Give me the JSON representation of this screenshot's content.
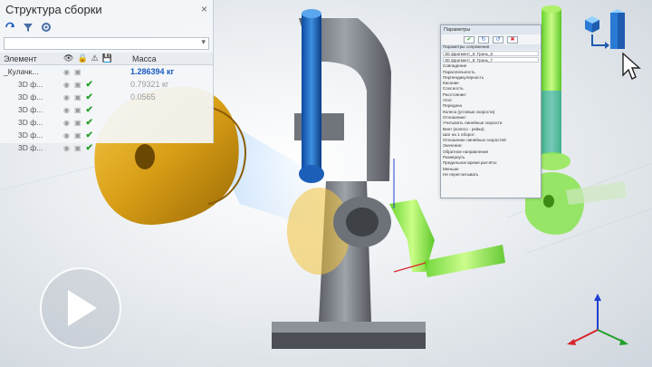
{
  "assembly_panel": {
    "title": "Структура сборки",
    "close_glyph": "×",
    "columns": {
      "element": "Элемент",
      "mass": "Масса"
    },
    "root": {
      "name": "_Кулачк...",
      "mass": "1.286394 кг"
    },
    "children": [
      {
        "name": "3D ф...",
        "mass": "0.79321 кг"
      },
      {
        "name": "3D ф...",
        "mass": "0.0565"
      },
      {
        "name": "3D ф...",
        "mass": ""
      },
      {
        "name": "3D ф...",
        "mass": ""
      },
      {
        "name": "3D ф...",
        "mass": ""
      },
      {
        "name": "3D ф...",
        "mass": ""
      }
    ]
  },
  "params_panel": {
    "title": "Параметры",
    "section_header": "Параметры сопряжения",
    "field1": "3D фрагмент_6: Грань_6",
    "field2": "3D фрагмент_6: Грань_7",
    "rows": [
      "Совпадение",
      "Параллельность",
      "Перпендикулярность",
      "Касание",
      "Соосность",
      "Расстояние:",
      "Угол:",
      "Передача",
      "Колеса (угловые скорости)",
      "Отношение:",
      "Учитывать линейные скорости",
      "Винт (колесо - рейка)",
      "Шаг на 1 оборот:",
      "Отношение линейных скоростей",
      "Значение:",
      "Обратное направление",
      "Развернуть",
      "Предельное время расчёта:",
      "Меньше",
      "Не пересчитывать"
    ]
  },
  "colors": {
    "accent_blue": "#1a5bc0",
    "ok_green": "#2aa02a",
    "gold": "#d4a21a",
    "lime": "#79e83a"
  },
  "icons": [
    "refresh-icon",
    "filter-icon",
    "settings-icon",
    "check-icon",
    "play-icon",
    "cursor-icon",
    "axis-triad-icon"
  ]
}
